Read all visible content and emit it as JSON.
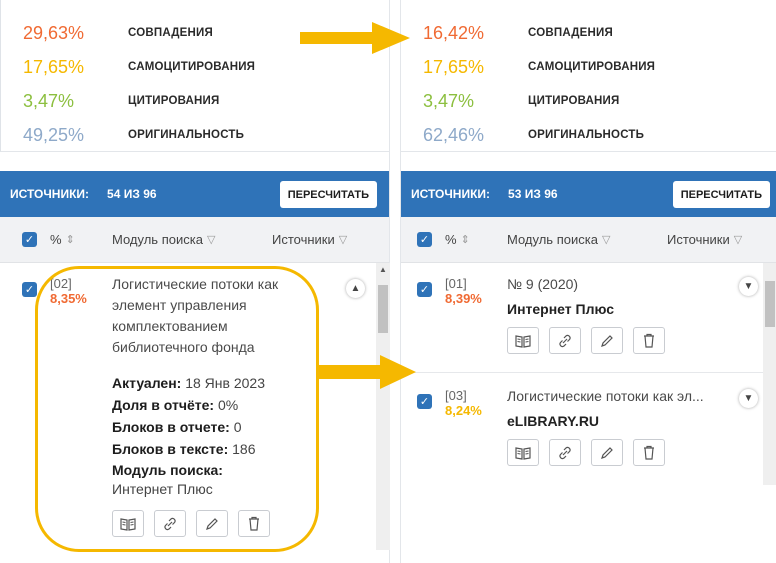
{
  "left": {
    "stats": [
      {
        "pct": "29,63%",
        "label": "СОВПАДЕНИЯ",
        "color": "#f06a33"
      },
      {
        "pct": "17,65%",
        "label": "САМОЦИТИРОВАНИЯ",
        "color": "#f5b800"
      },
      {
        "pct": "3,47%",
        "label": "ЦИТИРОВАНИЯ",
        "color": "#8cbf3f"
      },
      {
        "pct": "49,25%",
        "label": "ОРИГИНАЛЬНОСТЬ",
        "color": "#8ea9c9"
      }
    ],
    "header": {
      "title": "ИСТОЧНИКИ:",
      "count": "54 ИЗ 96",
      "recalc_label": "ПЕРЕСЧИТАТЬ"
    },
    "columns": {
      "pct": "%",
      "module": "Модуль поиска",
      "sources": "Источники"
    },
    "entry": {
      "index": "[02]",
      "percent": "8,35%",
      "title_lines": [
        "Логистические потоки как",
        "элемент управления",
        "комплектованием",
        "библиотечного фонда"
      ],
      "actual_label": "Актуален:",
      "actual_value": "18 Янв 2023",
      "share_label": "Доля в отчёте:",
      "share_value": "0%",
      "blocks_report_label": "Блоков в отчете:",
      "blocks_report_value": "0",
      "blocks_text_label": "Блоков в тексте:",
      "blocks_text_value": "186",
      "module_label": "Модуль поиска:",
      "module_value": "Интернет Плюс"
    }
  },
  "right": {
    "stats": [
      {
        "pct": "16,42%",
        "label": "СОВПАДЕНИЯ",
        "color": "#f06a33"
      },
      {
        "pct": "17,65%",
        "label": "САМОЦИТИРОВАНИЯ",
        "color": "#f5b800"
      },
      {
        "pct": "3,47%",
        "label": "ЦИТИРОВАНИЯ",
        "color": "#8cbf3f"
      },
      {
        "pct": "62,46%",
        "label": "ОРИГИНАЛЬНОСТЬ",
        "color": "#8ea9c9"
      }
    ],
    "header": {
      "title": "ИСТОЧНИКИ:",
      "count": "53 ИЗ 96",
      "recalc_label": "ПЕРЕСЧИТАТЬ"
    },
    "columns": {
      "pct": "%",
      "module": "Модуль поиска",
      "sources": "Источники"
    },
    "entries": [
      {
        "index": "[01]",
        "percent": "8,39%",
        "percent_color": "#f06a33",
        "title": "№ 9 (2020)",
        "source": "Интернет Плюс"
      },
      {
        "index": "[03]",
        "percent": "8,24%",
        "percent_color": "#f5b800",
        "title": "Логистические потоки как эл...",
        "source": "eLIBRARY.RU"
      }
    ]
  },
  "colors": {
    "accent": "#2f73b8",
    "highlight": "#f5b800"
  },
  "icons": [
    "checkbox-icon",
    "sort-icon",
    "filter-icon",
    "chevron-up-icon",
    "chevron-down-icon",
    "book-icon",
    "link-icon",
    "pencil-icon",
    "trash-icon",
    "arrow-right-icon"
  ]
}
